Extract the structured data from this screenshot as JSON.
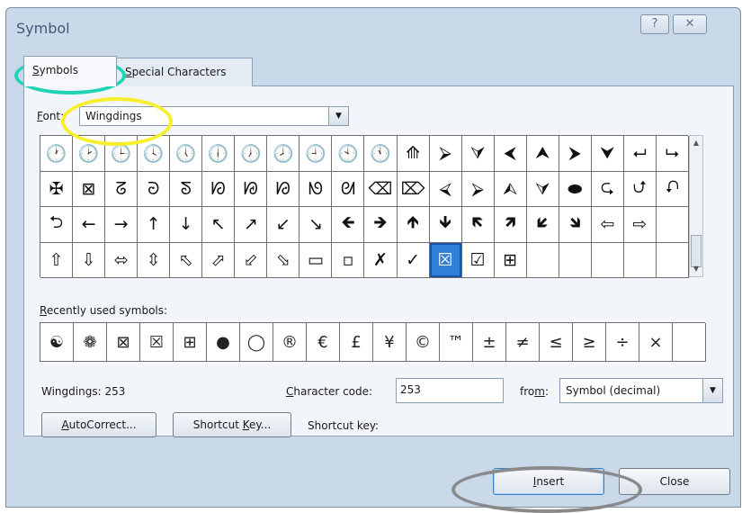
{
  "window": {
    "title": "Symbol",
    "help_glyph": "?",
    "close_glyph": "✕"
  },
  "tabs": [
    {
      "label_u": "S",
      "label_rest": "ymbols",
      "active": true
    },
    {
      "label_pre": "",
      "label_u": "S",
      "label_rest": "pecial Characters",
      "active": false
    }
  ],
  "font": {
    "label_u": "F",
    "label_mid": "ont",
    "label_colon": ":",
    "value": "Wingdings"
  },
  "symbol_grid": {
    "rows": [
      [
        "🕐",
        "🕑",
        "🕒",
        "🕓",
        "🕔",
        "🕕",
        "🕖",
        "🕗",
        "🕘",
        "🕙",
        "🕚",
        "⟰",
        "⮚",
        "⮛",
        "⮜",
        "⮝",
        "⮞",
        "⮟",
        "⮠",
        "⮡"
      ],
      [
        "✠",
        "⊠",
        "ᘔ",
        "ᘒ",
        "ᘕ",
        "ᘗ",
        "ᘘ",
        "ᘙ",
        "ᘚ",
        "ᘛ",
        "⌫",
        "⌦",
        "⮘",
        "⮚",
        "⮙",
        "⮛",
        "⬬",
        "⮎",
        "⮍",
        "⮏"
      ],
      [
        "⮌",
        "←",
        "→",
        "↑",
        "↓",
        "↖",
        "↗",
        "↙",
        "↘",
        "🡸",
        "🡺",
        "🡹",
        "🡻",
        "🡼",
        "🡽",
        "🡿",
        "🡾",
        "⇦",
        "⇨",
        ""
      ],
      [
        "⇧",
        "⇩",
        "⬄",
        "⇳",
        "⬁",
        "⬀",
        "⬃",
        "⬂",
        "▭",
        "▫",
        "✗",
        "✓",
        "☒",
        "☑",
        "⊞",
        "",
        "",
        "",
        "",
        ""
      ]
    ],
    "selected": {
      "row": 3,
      "col": 12
    }
  },
  "recent": {
    "label_u": "R",
    "label_rest": "ecently used symbols:",
    "symbols": [
      "☯",
      "❁",
      "⊠",
      "☒",
      "⊞",
      "●",
      "◯",
      "®",
      "€",
      "£",
      "¥",
      "©",
      "™",
      "±",
      "≠",
      "≤",
      "≥",
      "÷",
      "×",
      ""
    ]
  },
  "char_name": "Wingdings: 253",
  "char_code": {
    "label_u": "C",
    "label_rest": "haracter code:",
    "value": "253"
  },
  "from": {
    "label_pre": "fro",
    "label_u": "m",
    "label_colon": ":",
    "value": "Symbol (decimal)"
  },
  "buttons": {
    "autocorrect_u": "A",
    "autocorrect_rest": "utoCorrect...",
    "shortcut_pre": "Shortcut ",
    "shortcut_u": "K",
    "shortcut_rest": "ey...",
    "insert_u": "I",
    "insert_rest": "nsert",
    "close": "Close"
  },
  "shortcut_key_label": "Shortcut key:",
  "colors": {
    "highlight_teal": "#1fd3b4",
    "highlight_yellow": "#f7ef2d",
    "highlight_gray": "#8a8a8a",
    "selection": "#2f80d8"
  }
}
